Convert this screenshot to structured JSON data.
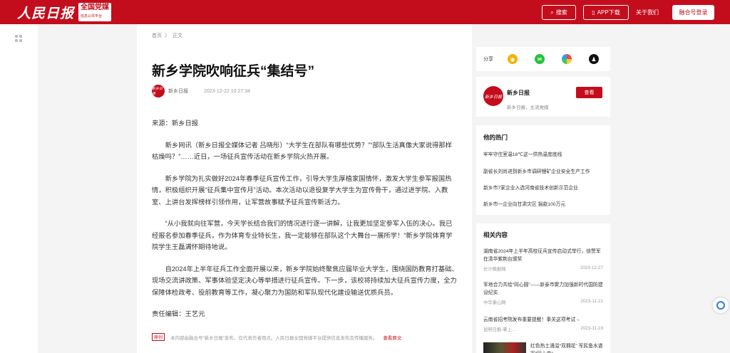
{
  "header": {
    "logo_main": "人民日报",
    "logo_sub": "全国党媒",
    "logo_sub_small": "信息公共平台",
    "search_label": "搜索",
    "app_label": "APP下载",
    "about_label": "关于我们",
    "login_label": "融合号登录",
    "brand_color": "#c40d1c"
  },
  "breadcrumb": {
    "home": "首页",
    "separator": "〉",
    "current": "正文"
  },
  "article": {
    "title": "新乡学院吹响征兵“集结号”",
    "source_avatar": "新乡日报",
    "source": "新乡日报",
    "datetime": "2023-12-22 10:27:34",
    "paragraphs": [
      "来源：新乡日报",
      "新乡网讯（新乡日报全媒体记者 吕晓彤）“大学生在部队有哪些优势？”“部队生活真像大家说得那样枯燥吗？”……近日，一场征兵宣传活动在新乡学院火热开展。",
      "新乡学院为扎实做好2024年春季征兵宣传工作，引导大学生厚植家国情怀，激发大学生参军报国热情，积极组织开展“征兵集中宣传月”活动。本次活动以退役复学大学生为宣传骨干，通过进学院、入教室、上讲台发挥榜样引领作用，让军营故事赋予征兵宣传新活力。",
      "“从小我就向往军营，今天学长结合我们的情况进行逐一讲解，让我更加坚定参军入伍的决心。我已经报名参加春季征兵，作为体育专业特长生，我一定能够在部队这个大舞台一展所学！”新乡学院体育学院学生王磊满怀期待地说。",
      "自2024年上半年征兵工作全面开展以来，新乡学院始终聚焦应届毕业大学生，围绕国防教育打基础、现场交流讲政策、军事体验坚定决心等举措进行征兵宣传。下一步，该校将持续加大征兵宣传力度，全力保障体检政考、役前教育等工作，凝心聚力为国防和军队现代化建设输送优质兵员。",
      "责任编辑：王艺元"
    ],
    "footnote_tag": "原创",
    "footnote_text": "本内容由融合号“新乡日报”发布，仅代表作者观点。人民日报全国党媒平台提供信息发布及传播服务。",
    "footnote_link": "查看原文"
  },
  "share": {
    "label": "分享",
    "icons": [
      "weibo-icon",
      "wechat-icon",
      "moments-icon",
      "qq-icon"
    ]
  },
  "author_card": {
    "avatar": "新乡日报",
    "name": "新乡日报",
    "desc": "新乡日报，主流党媒",
    "follow_label": "查看"
  },
  "hot": {
    "title": "他的热门",
    "items": [
      "牢牢守住室温18℃这一供热温度底线",
      "副省长刘尚进到新乡市调研锂矿企业安全生产工作",
      "新乡市7家企业入选河南省技术创新示范企业",
      "新乡市一企业向甘肃灾区 捐款100万元"
    ]
  },
  "related": {
    "title": "相关内容",
    "items": [
      {
        "title": "湖南省2024年上半年高校征兵宣传启动式举行，徐赞军在清华紫荆台颁奖",
        "source": "长沙晚报网",
        "date": "2023-12-27"
      },
      {
        "title": "军地合力共绘“同心圆”——新泰市聚力加强新时代国防建设纪实",
        "source": "中华泰山网",
        "date": "2023-11-21"
      },
      {
        "title": "云南省招考院发布重要提醒！事关这项考试→",
        "source": "昆明日报-掌上...",
        "date": "2023-11-19"
      },
      {
        "title": "红色热土涌溢“双拥花” 军民鱼水谱写“同心曲”",
        "source": "",
        "date": ""
      }
    ]
  }
}
